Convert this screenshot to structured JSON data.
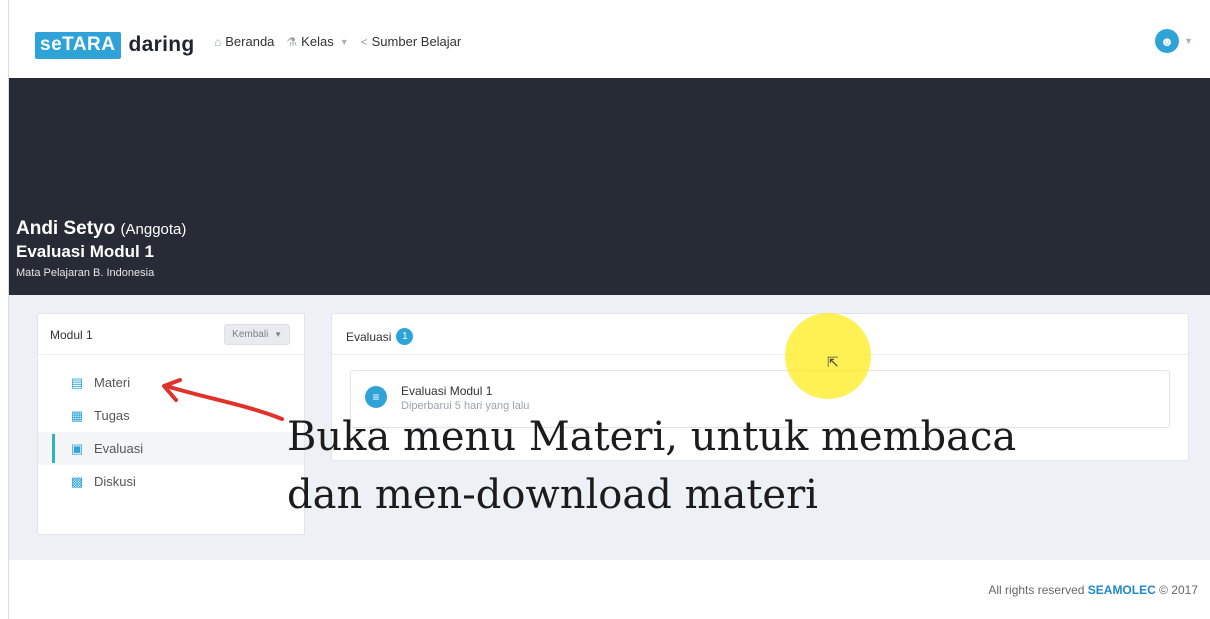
{
  "brand": {
    "prefix": "seTARA",
    "suffix": "daring"
  },
  "nav": [
    {
      "label": "Beranda",
      "icon": "home-icon"
    },
    {
      "label": "Kelas",
      "icon": "users-icon",
      "dropdown": true
    },
    {
      "label": "Sumber Belajar",
      "icon": "share-icon"
    }
  ],
  "user": {
    "avatar_icon": "user-avatar-icon"
  },
  "hero": {
    "name": "Andi Setyo",
    "role": "(Anggota)",
    "title": "Evaluasi Modul 1",
    "subject": "Mata Pelajaran B. Indonesia"
  },
  "sidebar": {
    "title": "Modul 1",
    "back_label": "Kembali",
    "items": [
      {
        "label": "Materi",
        "icon": "book-icon",
        "color": "#2fa3d8"
      },
      {
        "label": "Tugas",
        "icon": "file-icon",
        "color": "#2fa3d8"
      },
      {
        "label": "Evaluasi",
        "icon": "clipboard-icon",
        "color": "#2fa3d8",
        "active": true
      },
      {
        "label": "Diskusi",
        "icon": "chat-icon",
        "color": "#2fa3d8"
      }
    ]
  },
  "main": {
    "title": "Evaluasi",
    "count": "1",
    "card": {
      "title": "Evaluasi Modul 1",
      "updated": "Diperbarui 5 hari yang lalu"
    }
  },
  "footer": {
    "text": "All rights reserved",
    "brand": "SEAMOLEC",
    "year": "© 2017"
  },
  "annotation": {
    "line1": "Buka menu Materi, untuk membaca",
    "line2": "dan men-download materi"
  },
  "colors": {
    "accent": "#2fa3d8",
    "hero_bg": "#262b35",
    "arrow": "#e0312b",
    "highlight": "#ffec28"
  }
}
